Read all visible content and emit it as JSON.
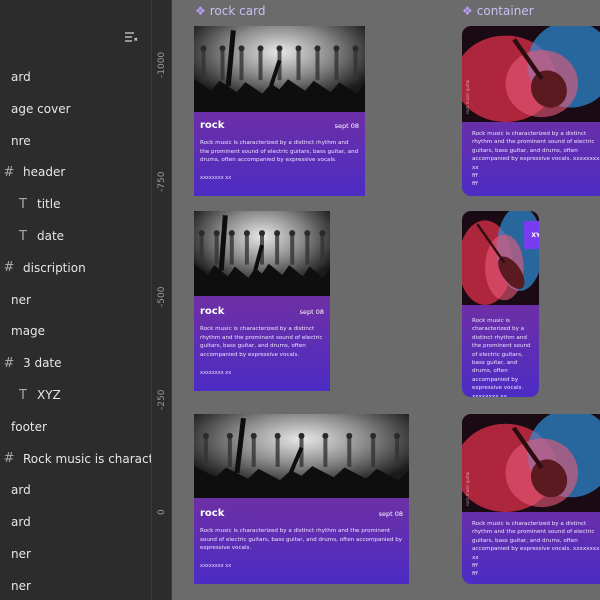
{
  "layers_panel": {
    "items": [
      {
        "label": "ard",
        "icon": "frame-icon",
        "indent": 0
      },
      {
        "label": "age cover",
        "icon": "image-icon",
        "indent": 0
      },
      {
        "label": "nre",
        "icon": "frame-icon",
        "indent": 0
      },
      {
        "label": "header",
        "icon": "frame-icon",
        "indent": 1
      },
      {
        "label": "title",
        "icon": "text-icon",
        "indent": 2
      },
      {
        "label": "date",
        "icon": "text-icon",
        "indent": 2
      },
      {
        "label": "discription",
        "icon": "frame-icon",
        "indent": 1
      },
      {
        "label": "ner",
        "icon": "frame-icon",
        "indent": 0
      },
      {
        "label": "mage",
        "icon": "image-icon",
        "indent": 0
      },
      {
        "label": "3 date",
        "icon": "frame-icon",
        "indent": 1
      },
      {
        "label": "XYZ",
        "icon": "text-icon",
        "indent": 2
      },
      {
        "label": "footer",
        "icon": "frame-icon",
        "indent": 0
      },
      {
        "label": "Rock music is characterized",
        "icon": "frame-icon",
        "indent": 1
      },
      {
        "label": "ard",
        "icon": "frame-icon",
        "indent": 0
      },
      {
        "label": "ard",
        "icon": "frame-icon",
        "indent": 0
      },
      {
        "label": "ner",
        "icon": "frame-icon",
        "indent": 0
      },
      {
        "label": "ner",
        "icon": "frame-icon",
        "indent": 0
      }
    ]
  },
  "ruler": {
    "ticks": [
      "-1000",
      "-750",
      "-500",
      "-250",
      "0"
    ]
  },
  "canvas": {
    "rock_frame_label": "rock card",
    "container_frame_label": "container"
  },
  "rock_cards": [
    {
      "title": "rock",
      "date": "sept 08",
      "desc": "Rock music is characterized by a distinct rhythm and the prominent sound of electric guitars, bass guitar, and drums, often accompanied by expressive vocals.",
      "footer": "xxxxxxxx  xx"
    },
    {
      "title": "rock",
      "date": "sept 08",
      "desc": "Rock music is characterized by a distinct rhythm and the prominent sound of electric guitars, bass guitar, and drums, often accompanied by expressive vocals.",
      "footer": "xxxxxxxx  xx"
    },
    {
      "title": "rock",
      "date": "sept 08",
      "desc": "Rock music is characterized by a distinct rhythm and the prominent sound of electric guitars, bass guitar, and drums, often accompanied by expressive vocals.",
      "footer": "xxxxxxxx  xx"
    }
  ],
  "container_cards": [
    {
      "badge": "",
      "desc": "Rock music is characterized by a distinct rhythm and the prominent sound of electric guitars, bass guitar, and drums, often accompanied by expressive vocals. xxxxxxxx  xx\nfff\nfff",
      "side": "rock music guitar"
    },
    {
      "badge": "XYZ",
      "desc": "Rock music is characterized by a distinct rhythm and the prominent sound of electric guitars, bass guitar, and drums, often accompanied by expressive vocals. xxxxxxxx  xx\nfff\nfff",
      "side": ""
    },
    {
      "badge": "",
      "desc": "Rock music is characterized by a distinct rhythm and the prominent sound of electric guitars, bass guitar, and drums, often accompanied by expressive vocals. xxxxxxxx  xx\nfff\nfff",
      "side": "rock music guitar"
    }
  ],
  "colors": {
    "panel_bg": "#2c2c2c",
    "canvas_bg": "#6b6b6b",
    "card_gradient_top": "#7b3098",
    "card_gradient_bottom": "#4c2cc4",
    "frame_label": "#c8bff6",
    "badge": "#7a3cf0"
  }
}
